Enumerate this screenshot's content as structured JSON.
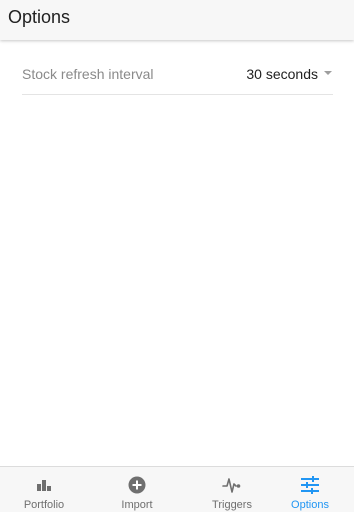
{
  "appbar": {
    "title": "Options"
  },
  "settings": {
    "refresh": {
      "label": "Stock refresh interval",
      "value": "30 seconds"
    }
  },
  "bottom_nav": {
    "items": [
      {
        "label": "Portfolio",
        "icon": "bar-chart-icon"
      },
      {
        "label": "Import",
        "icon": "add-circle-icon"
      },
      {
        "label": "Triggers",
        "icon": "pulse-icon"
      },
      {
        "label": "Options",
        "icon": "sliders-icon",
        "active": true
      }
    ]
  },
  "colors": {
    "accent": "#2196f3",
    "inactive_icon": "#6f6f6f",
    "bar_background": "#f7f7f7"
  }
}
